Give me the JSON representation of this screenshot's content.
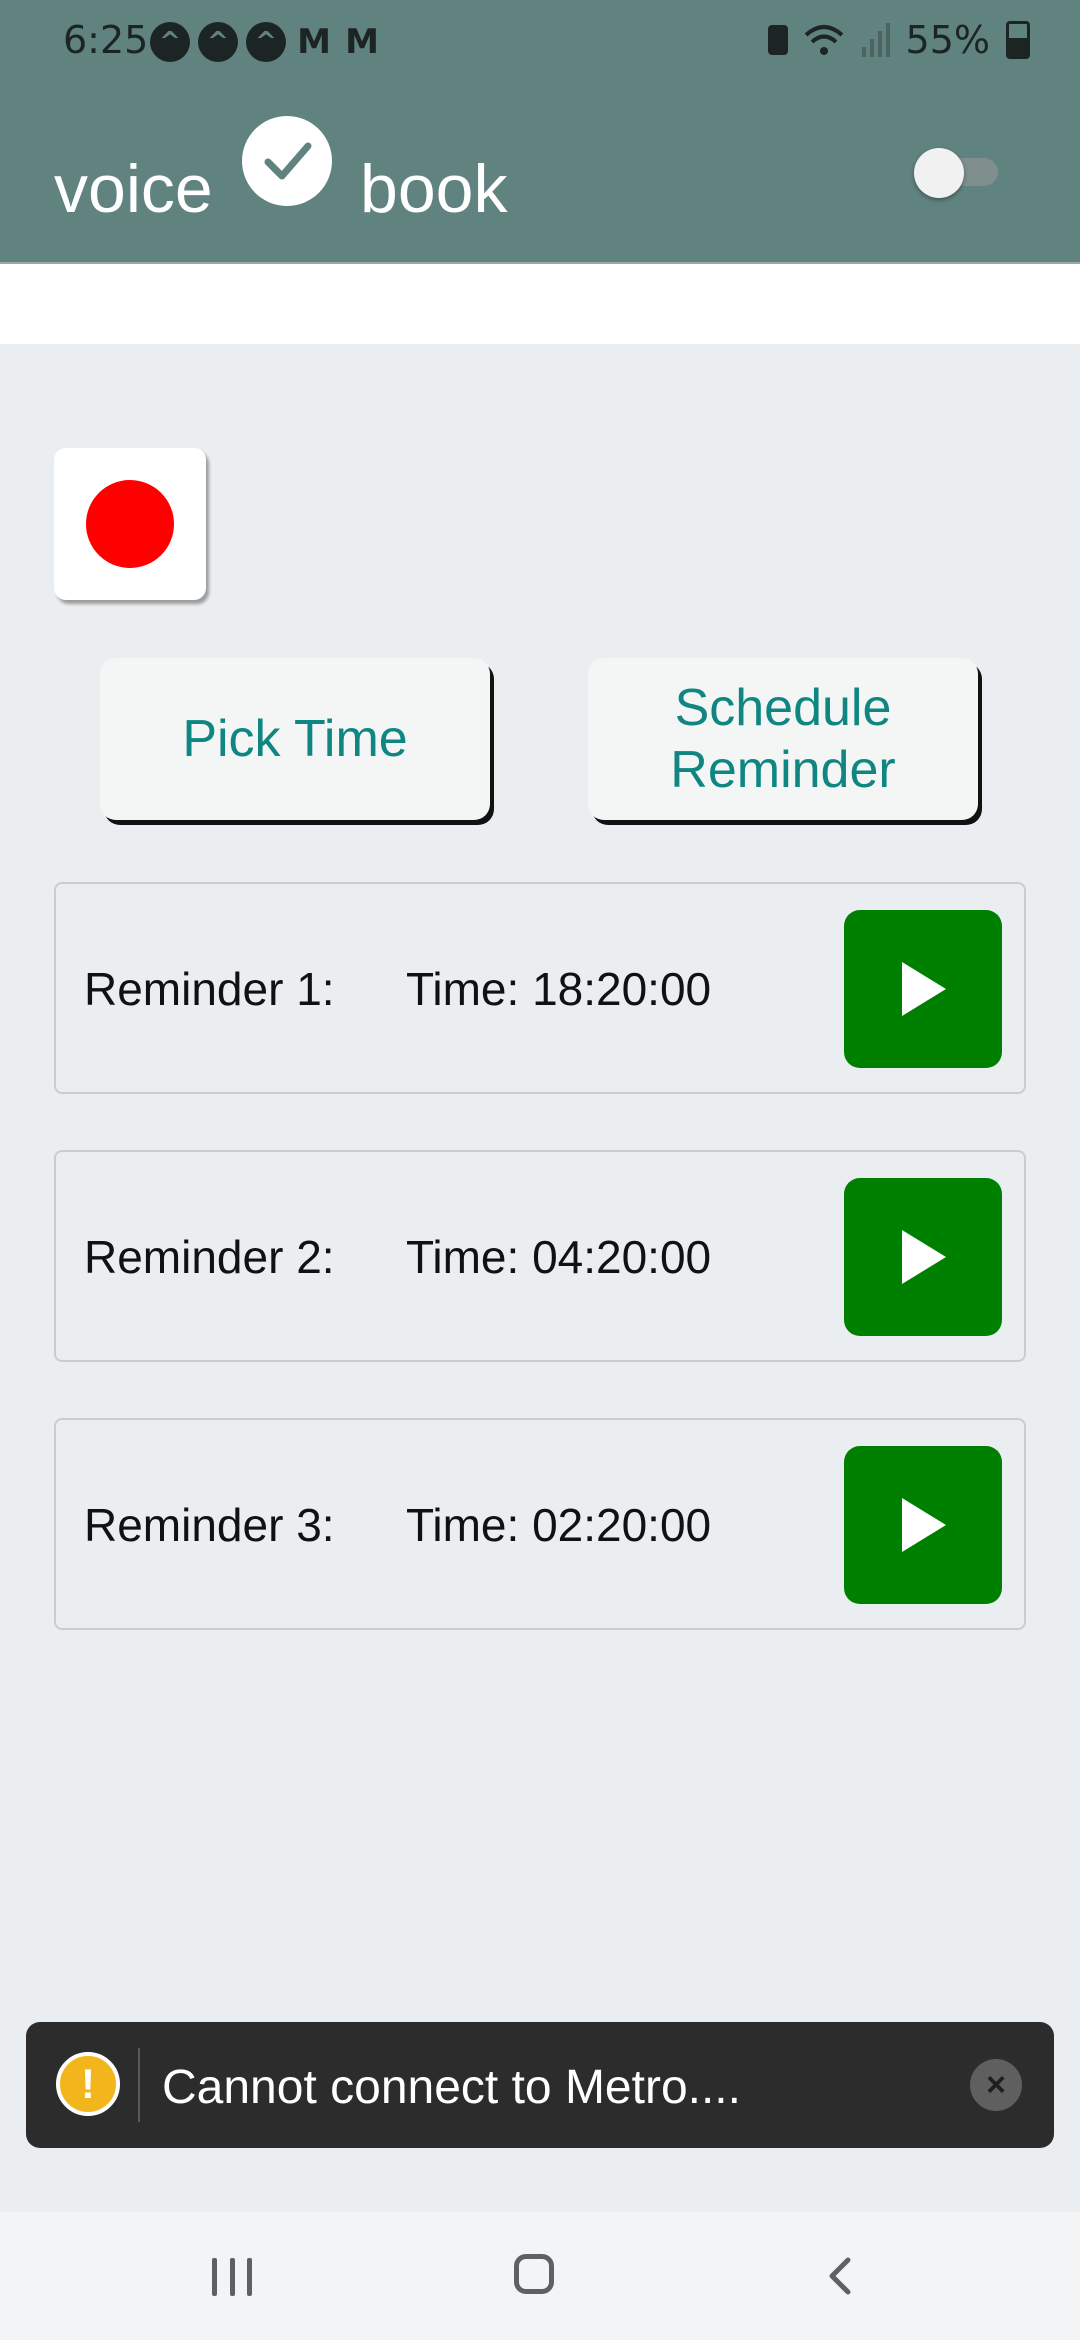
{
  "status_bar": {
    "time": "6:25",
    "notification_icons": [
      "a-icon",
      "a-icon",
      "a-icon",
      "gmail-icon",
      "gmail-icon"
    ],
    "battery_percent": "55%"
  },
  "header": {
    "title_left": "voice",
    "title_right": "book",
    "logo_icon": "checkmark-circle-icon",
    "toggle_on": false
  },
  "record": {
    "icon": "record-dot-icon",
    "color": "#ff0000"
  },
  "actions": {
    "pick_time_label": "Pick Time",
    "schedule_label_line1": "Schedule",
    "schedule_label_line2": "Reminder"
  },
  "reminders": [
    {
      "label": "Reminder 1:",
      "time": "Time: 18:20:00"
    },
    {
      "label": "Reminder 2:",
      "time": "Time: 04:20:00"
    },
    {
      "label": "Reminder 3:",
      "time": "Time: 02:20:00"
    }
  ],
  "toast": {
    "message": "Cannot connect to Metro...."
  },
  "colors": {
    "header_bg": "#608380",
    "accent_text": "#0f8682",
    "play_button": "#008000",
    "toast_warning": "#f3b51c"
  }
}
